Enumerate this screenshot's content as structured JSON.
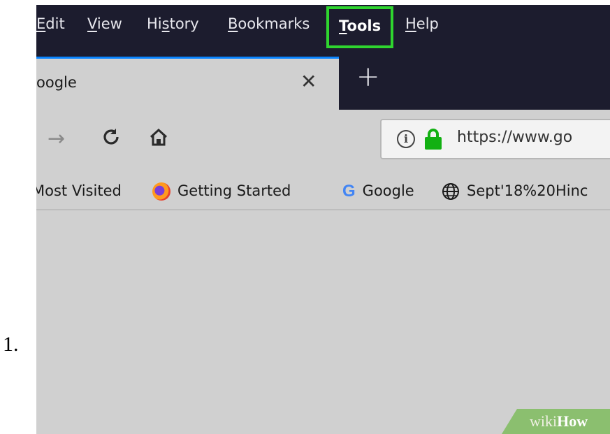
{
  "step": {
    "number": "1."
  },
  "menubar": {
    "items": [
      {
        "label": "Edit",
        "accel": "E",
        "rest": "dit"
      },
      {
        "label": "View",
        "accel": "V",
        "rest": "iew"
      },
      {
        "label": "History",
        "pre": "Hi",
        "accel": "s",
        "rest": "tory"
      },
      {
        "label": "Bookmarks",
        "accel": "B",
        "rest": "ookmarks"
      },
      {
        "label": "Tools",
        "accel": "T",
        "rest": "ools",
        "highlighted": true
      },
      {
        "label": "Help",
        "accel": "H",
        "rest": "elp"
      }
    ],
    "highlight_color": "#2fd52f"
  },
  "tabs": {
    "active_title": "Google",
    "visible_title": "oogle",
    "close_glyph": "✕",
    "new_tab_glyph": "+"
  },
  "toolbar": {
    "forward_icon": "arrow-right-icon",
    "reload_icon": "reload-icon",
    "home_icon": "home-icon",
    "url_text": "https://www.go",
    "secure": true
  },
  "bookmarks": [
    {
      "label": "Most Visited",
      "visible": "Most Visited",
      "icon": "none"
    },
    {
      "label": "Getting Started",
      "icon": "firefox-icon"
    },
    {
      "label": "Google",
      "icon": "google-g-icon"
    },
    {
      "label": "Sept'18%20Hinc",
      "icon": "globe-icon"
    }
  ],
  "watermark": {
    "wiki": "wiki",
    "how": "How"
  },
  "colors": {
    "menubar_bg": "#1c1c2e",
    "content_bg": "#d0d0d0",
    "lock_green": "#12b012",
    "tab_accent": "#0a84ff"
  }
}
